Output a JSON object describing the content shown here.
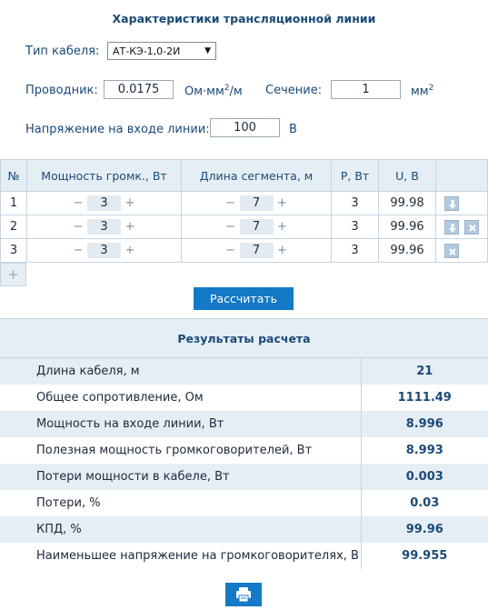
{
  "title": "Характеристики трансляционной линии",
  "cable": {
    "label": "Тип кабеля:",
    "selected": "АТ-КЭ-1,0-2И"
  },
  "conductor": {
    "label": "Проводник:",
    "value": "0.0175",
    "unit_text": "Ом·мм",
    "unit_sup": "2",
    "unit_tail": "/м"
  },
  "section": {
    "label": "Сечение:",
    "value": "1",
    "unit_text": "мм",
    "unit_sup": "2"
  },
  "voltage": {
    "label": "Напряжение на входе линии:",
    "value": "100",
    "unit": "В"
  },
  "segments": {
    "headers": [
      "№",
      "Мощность громк., Вт",
      "Длина сегмента, м",
      "P, Вт",
      "U, В"
    ],
    "minus": "−",
    "plus": "+",
    "rows": [
      {
        "n": "1",
        "power": "3",
        "length": "7",
        "p": "3",
        "u": "99.98"
      },
      {
        "n": "2",
        "power": "3",
        "length": "7",
        "p": "3",
        "u": "99.96"
      },
      {
        "n": "3",
        "power": "3",
        "length": "7",
        "p": "3",
        "u": "99.96"
      }
    ],
    "add_symbol": "+"
  },
  "calc_button": "Рассчитать",
  "results": {
    "title": "Результаты расчета",
    "rows": [
      {
        "label": "Длина кабеля, м",
        "value": "21"
      },
      {
        "label": "Общее сопротивление, Ом",
        "value": "1111.49"
      },
      {
        "label": "Мощность на входе линии, Вт",
        "value": "8.996"
      },
      {
        "label": "Полезная мощность громкоговорителей, Вт",
        "value": "8.993"
      },
      {
        "label": "Потери мощности в кабеле, Вт",
        "value": "0.003"
      },
      {
        "label": "Потери, %",
        "value": "0.03"
      },
      {
        "label": "КПД, %",
        "value": "99.96"
      },
      {
        "label": "Наименьшее напряжение на громкоговорителях, В",
        "value": "99.955"
      }
    ]
  },
  "icons": {
    "move_down": "arrow-down-icon",
    "delete": "close-icon",
    "print": "printer-icon"
  },
  "colors": {
    "accent": "#1479c6",
    "header_bg": "#e6eef5",
    "title": "#1a4a78"
  }
}
